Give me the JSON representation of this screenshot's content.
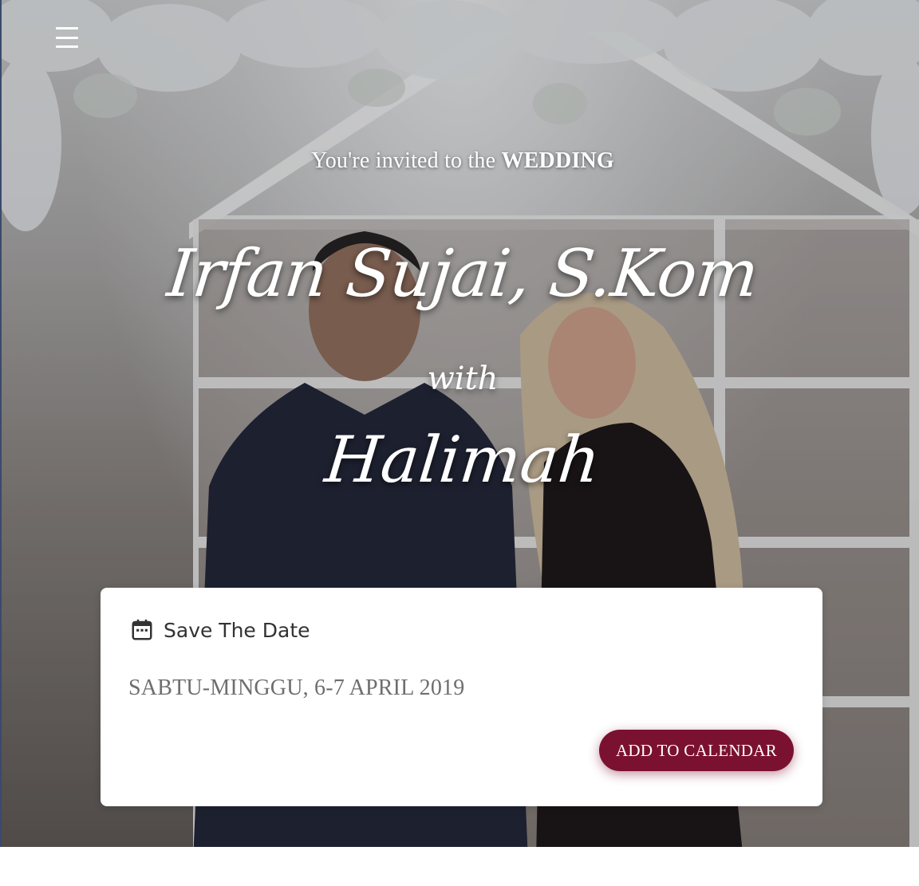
{
  "menu": {
    "icon": "hamburger-menu-icon"
  },
  "hero": {
    "invite_prefix": "You're invited to the ",
    "invite_highlight": "WEDDING",
    "groom_name": "Irfan Sujai, S.Kom",
    "connector": "with",
    "bride_name": "Halimah"
  },
  "save_the_date": {
    "icon": "calendar-icon",
    "title": "Save The Date",
    "date_text": "SABTU-MINGGU, 6-7 APRIL 2019",
    "button_label": "ADD TO CALENDAR"
  },
  "colors": {
    "accent": "#7b1130",
    "card_text": "#333333",
    "date_text": "#6e6e6e"
  }
}
